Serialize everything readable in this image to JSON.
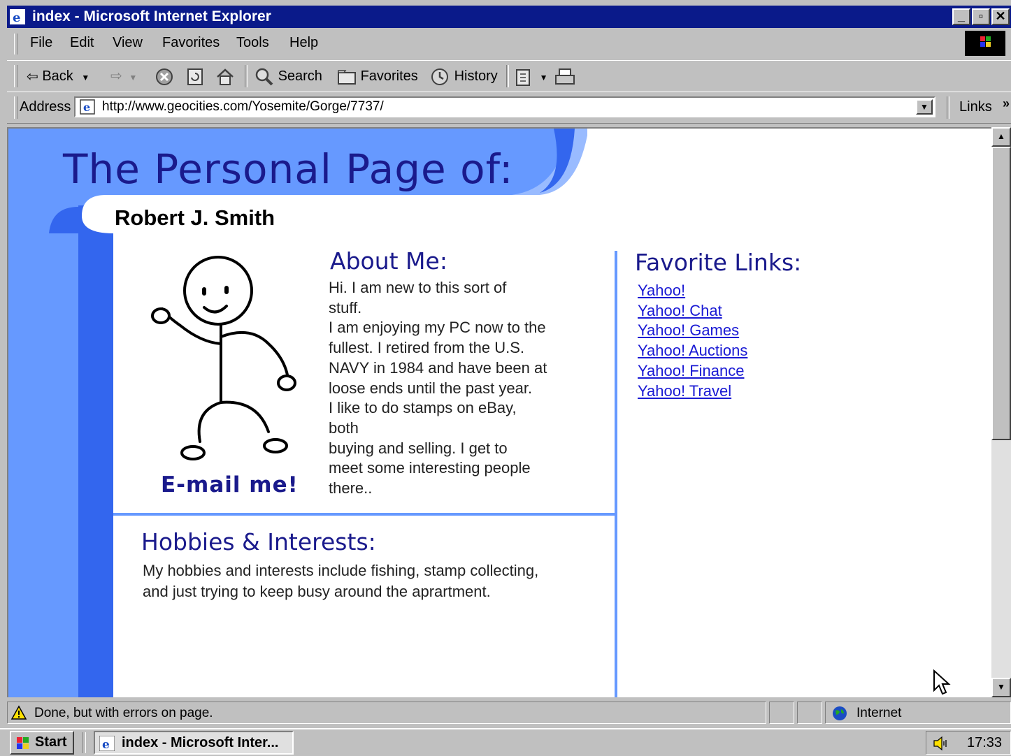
{
  "window": {
    "title": "index - Microsoft Internet Explorer"
  },
  "menu": [
    "File",
    "Edit",
    "View",
    "Favorites",
    "Tools",
    "Help"
  ],
  "toolbar": {
    "back": "Back",
    "search": "Search",
    "favorites": "Favorites",
    "history": "History"
  },
  "address": {
    "label": "Address",
    "url": "http://www.geocities.com/Yosemite/Gorge/7737/",
    "links": "Links"
  },
  "page": {
    "title": "The Personal Page of:",
    "name": "Robert J. Smith",
    "email": "E-mail me!",
    "about_heading": "About Me:",
    "about_lines": [
      "Hi.  I am new to this sort of",
      "stuff.",
      "I am enjoying my PC now to the",
      "fullest.  I retired from the U.S.",
      "NAVY in 1984 and have been at",
      "loose ends until the past year.",
      "I like to do stamps on eBay,",
      "both",
      "buying and selling.  I get to",
      "meet some interesting people",
      "there.."
    ],
    "hobbies_heading": "Hobbies & Interests:",
    "hobbies_lines": [
      "My hobbies and interests include fishing,  stamp collecting,",
      "and just trying to keep busy around the aprartment."
    ],
    "links_heading": "Favorite Links:",
    "links": [
      "Yahoo!",
      "Yahoo! Chat",
      "Yahoo! Games",
      "Yahoo! Auctions",
      "Yahoo! Finance",
      "Yahoo! Travel"
    ],
    "colors": {
      "accent_blue": "#6699ff",
      "light_blue": "#99bbff",
      "heading": "#1a1a8c",
      "link": "#1a1ad4"
    }
  },
  "status": {
    "text": "Done, but with errors on page.",
    "zone": "Internet"
  },
  "taskbar": {
    "start": "Start",
    "task": "index - Microsoft Inter...",
    "clock": "17:33"
  }
}
